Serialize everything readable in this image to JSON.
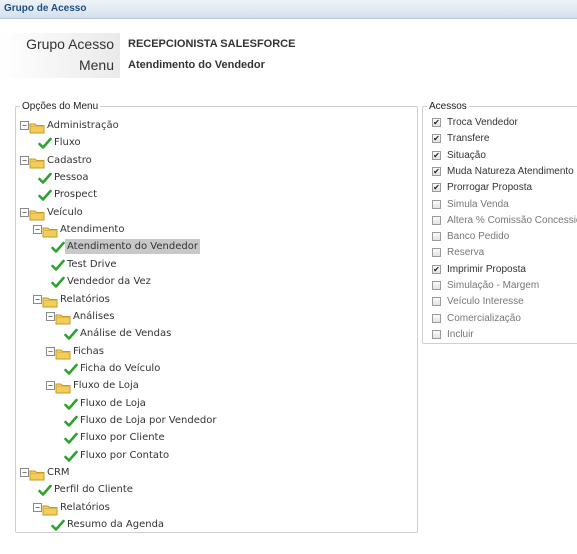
{
  "window": {
    "title": "Grupo de Acesso"
  },
  "header": {
    "grupo_label": "Grupo Acesso",
    "grupo_value": "RECEPCIONISTA SALESFORCE",
    "menu_label": "Menu",
    "menu_value": "Atendimento do Vendedor"
  },
  "menu_panel": {
    "legend": "Opções do Menu",
    "nodes": [
      {
        "label": "Administração",
        "kind": "folder",
        "level": 0
      },
      {
        "label": "Fluxo",
        "kind": "leaf",
        "level": 1
      },
      {
        "label": "Cadastro",
        "kind": "folder",
        "level": 0
      },
      {
        "label": "Pessoa",
        "kind": "leaf",
        "level": 1
      },
      {
        "label": "Prospect",
        "kind": "leaf",
        "level": 1
      },
      {
        "label": "Veículo",
        "kind": "folder",
        "level": 0
      },
      {
        "label": "Atendimento",
        "kind": "folder",
        "level": 1
      },
      {
        "label": "Atendimento do Vendedor",
        "kind": "leaf",
        "level": 2,
        "selected": true
      },
      {
        "label": "Test Drive",
        "kind": "leaf",
        "level": 2
      },
      {
        "label": "Vendedor da Vez",
        "kind": "leaf",
        "level": 2
      },
      {
        "label": "Relatórios",
        "kind": "folder",
        "level": 1
      },
      {
        "label": "Análises",
        "kind": "folder",
        "level": 2
      },
      {
        "label": "Análise de Vendas",
        "kind": "leaf",
        "level": 3
      },
      {
        "label": "Fichas",
        "kind": "folder",
        "level": 2
      },
      {
        "label": "Ficha do Veículo",
        "kind": "leaf",
        "level": 3
      },
      {
        "label": "Fluxo de Loja",
        "kind": "folder",
        "level": 2
      },
      {
        "label": "Fluxo de Loja",
        "kind": "leaf",
        "level": 3
      },
      {
        "label": "Fluxo de Loja por Vendedor",
        "kind": "leaf",
        "level": 3
      },
      {
        "label": "Fluxo por Cliente",
        "kind": "leaf",
        "level": 3
      },
      {
        "label": "Fluxo por Contato",
        "kind": "leaf",
        "level": 3
      },
      {
        "label": "CRM",
        "kind": "folder",
        "level": 0
      },
      {
        "label": "Perfil do Cliente",
        "kind": "leaf",
        "level": 1
      },
      {
        "label": "Relatórios",
        "kind": "folder",
        "level": 1
      },
      {
        "label": "Resumo da Agenda",
        "kind": "leaf",
        "level": 2
      }
    ]
  },
  "access_panel": {
    "legend": "Acessos",
    "items": [
      {
        "label": "Troca Vendedor",
        "checked": true
      },
      {
        "label": "Transfere",
        "checked": true
      },
      {
        "label": "Situação",
        "checked": true
      },
      {
        "label": "Muda Natureza Atendimento",
        "checked": true
      },
      {
        "label": "Prorrogar Proposta",
        "checked": true
      },
      {
        "label": "Simula Venda",
        "checked": false
      },
      {
        "label": "Altera % Comissão Concession",
        "checked": false
      },
      {
        "label": "Banco Pedido",
        "checked": false
      },
      {
        "label": "Reserva",
        "checked": false
      },
      {
        "label": "Imprimir Proposta",
        "checked": true
      },
      {
        "label": "Simulação - Margem",
        "checked": false
      },
      {
        "label": "Veículo Interesse",
        "checked": false
      },
      {
        "label": "Comercialização",
        "checked": false
      },
      {
        "label": "Incluir",
        "checked": false
      }
    ]
  },
  "colors": {
    "check_green": "#2fa12f",
    "folder_yellow": "#f3cd5a",
    "title_text": "#1f4f82"
  }
}
